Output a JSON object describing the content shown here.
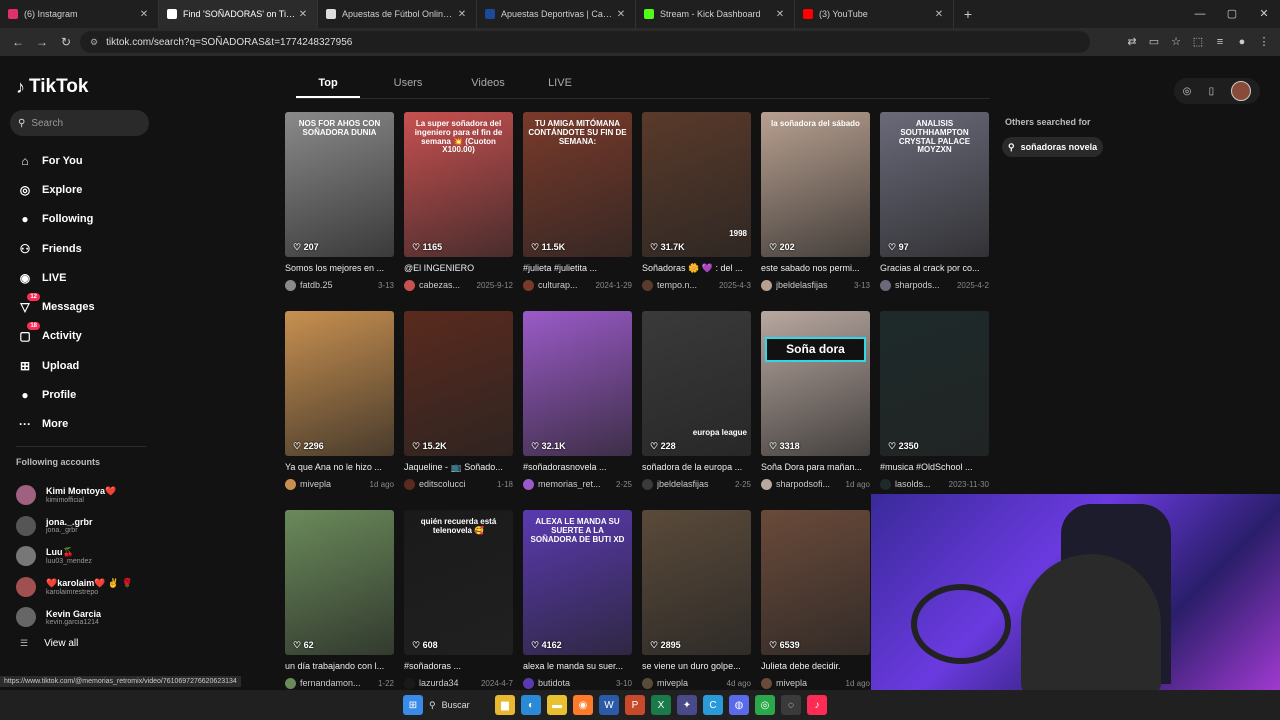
{
  "browser": {
    "tabs": [
      {
        "label": "(6) Instagram",
        "icon": "instagram-icon",
        "color": "#e1306c",
        "active": false
      },
      {
        "label": "Find 'SOÑADORAS' on TikTok | TikTok",
        "icon": "tiktok-icon",
        "color": "#ffffff",
        "active": true
      },
      {
        "label": "Apuestas de Fútbol Online - La",
        "icon": "dollar-icon",
        "color": "#dddddd",
        "active": false
      },
      {
        "label": "Apuestas Deportivas | Casa de A",
        "icon": "betting-icon",
        "color": "#1a4a9a",
        "active": false
      },
      {
        "label": "Stream - Kick Dashboard",
        "icon": "kick-icon",
        "color": "#53fc18",
        "active": false
      },
      {
        "label": "(3) YouTube",
        "icon": "youtube-icon",
        "color": "#ff0000",
        "active": false
      }
    ],
    "new_tab": "+",
    "url": "tiktok.com/search?q=SOÑADORAS&t=1774248327956",
    "status_url": "https://www.tiktok.com/@memorias_retromix/video/7610697276620623134"
  },
  "sidebar": {
    "logo": "TikTok",
    "search_placeholder": "Search",
    "nav": [
      {
        "label": "For You",
        "icon": "home-icon",
        "glyph": "⌂"
      },
      {
        "label": "Explore",
        "icon": "compass-icon",
        "glyph": "◎"
      },
      {
        "label": "Following",
        "icon": "following-avatar-icon",
        "glyph": "●"
      },
      {
        "label": "Friends",
        "icon": "friends-icon",
        "glyph": "⚇"
      },
      {
        "label": "LIVE",
        "icon": "live-icon",
        "glyph": "◉"
      },
      {
        "label": "Messages",
        "icon": "messages-icon",
        "glyph": "▽",
        "badge": "12"
      },
      {
        "label": "Activity",
        "icon": "activity-icon",
        "glyph": "▢",
        "badge": "18"
      },
      {
        "label": "Upload",
        "icon": "upload-icon",
        "glyph": "⊞"
      },
      {
        "label": "Profile",
        "icon": "profile-icon",
        "glyph": "●"
      },
      {
        "label": "More",
        "icon": "more-icon",
        "glyph": "···"
      }
    ],
    "following_title": "Following accounts",
    "following": [
      {
        "name": "Kimi Montoya❤️",
        "handle": "kimimofficial",
        "color": "#a06080"
      },
      {
        "name": "jona._.grbr",
        "handle": "jona._grbr",
        "color": "#555555"
      },
      {
        "name": "Luu🍒",
        "handle": "luu03_mendez",
        "color": "#777777"
      },
      {
        "name": "❤️karolaim❤️ ✌️ 🌹",
        "handle": "karolaimrestrepo",
        "color": "#a05050"
      },
      {
        "name": "Kevin Garcia",
        "handle": "kevin.garcia1214",
        "color": "#666666"
      }
    ],
    "view_all": "View all"
  },
  "search_tabs": [
    {
      "label": "Top",
      "active": true
    },
    {
      "label": "Users",
      "active": false
    },
    {
      "label": "Videos",
      "active": false
    },
    {
      "label": "LIVE",
      "active": false
    }
  ],
  "others": {
    "title": "Others searched for",
    "chip": "soñadoras novela"
  },
  "videos": [
    {
      "views": "207",
      "caption": "Somos los mejores en ...",
      "author": "fatdb.25",
      "date": "3-13",
      "bg": "#8a8a8a",
      "overlay": "NOS FOR AHOS CON SOÑADORA DUNIA"
    },
    {
      "views": "1165",
      "caption": "@El INGENIERO",
      "author": "cabezas...",
      "date": "2025-9-12",
      "bg": "#c85050",
      "overlay": "La super soñadora del ingeniero para el fin de semana 💥 (Cuoton X100.00)"
    },
    {
      "views": "11.5K",
      "caption": "#julieta #julietita ...",
      "author": "culturap...",
      "date": "2024-1-29",
      "bg": "#7a3a2a",
      "overlay": "TU AMIGA MITÓMANA CONTÁNDOTE SU FIN DE SEMANA:"
    },
    {
      "views": "31.7K",
      "caption": "Soñadoras 🌼 💜 : del ...",
      "author": "tempo.n...",
      "date": "2025-4-3",
      "bg": "#5a3a2a",
      "overlay": "1998"
    },
    {
      "views": "202",
      "caption": "este sabado nos permi...",
      "author": "jbeldelasfijas",
      "date": "3-13",
      "bg": "#b8a090",
      "overlay": "la soñadora del sábado"
    },
    {
      "views": "97",
      "caption": "Gracias al crack por co...",
      "author": "sharpods...",
      "date": "2025-4-2",
      "bg": "#6a6a7a",
      "overlay": "ANALISIS SOUTHHAMPTON CRYSTAL PALACE MOYZXN"
    },
    {
      "views": "2296",
      "caption": "Ya que Ana no le hizo ...",
      "author": "mivepla",
      "date": "1d ago",
      "bg": "#c89050",
      "overlay": ""
    },
    {
      "views": "15.2K",
      "caption": "Jaqueline - 📺 Soñado...",
      "author": "editscolucci",
      "date": "1-18",
      "bg": "#5a2a1e",
      "overlay": ""
    },
    {
      "views": "32.1K",
      "caption": "#soñadorasnovela ...",
      "author": "memorias_ret...",
      "date": "2-25",
      "bg": "#9a5ac8",
      "overlay": ""
    },
    {
      "views": "228",
      "caption": "soñadora de la europa ...",
      "author": "jbeldelasfijas",
      "date": "2-25",
      "bg": "#3a3a3a",
      "overlay": "europa league"
    },
    {
      "views": "3318",
      "caption": "Soña Dora para mañan...",
      "author": "sharpodsofi...",
      "date": "1d ago",
      "bg": "#b8a8a0",
      "overlay": "Soña dora"
    },
    {
      "views": "2350",
      "caption": "#musica #OldSchool ...",
      "author": "lasolds...",
      "date": "2023-11-30",
      "bg": "#1e2a2a",
      "overlay": ""
    },
    {
      "views": "62",
      "caption": "un día trabajando con l...",
      "author": "fernandamon...",
      "date": "1-22",
      "bg": "#6a8a5a",
      "overlay": ""
    },
    {
      "views": "608",
      "caption": "#soñadoras ...",
      "author": "lazurda34",
      "date": "2024-4-7",
      "bg": "#1a1a1a",
      "overlay": "quién recuerda está telenovela 🥰"
    },
    {
      "views": "4162",
      "caption": "alexa le manda su suer...",
      "author": "butidota",
      "date": "3-10",
      "bg": "#5a3ab0",
      "overlay": "ALEXA LE MANDA SU SUERTE A LA SOÑADORA DE BUTI XD"
    },
    {
      "views": "2895",
      "caption": "se viene un duro golpe...",
      "author": "mivepla",
      "date": "4d ago",
      "bg": "#5a4a3a",
      "overlay": ""
    },
    {
      "views": "6539",
      "caption": "Julieta debe decidir.",
      "author": "mivepla",
      "date": "1d ago",
      "bg": "#6a4a3a",
      "overlay": ""
    }
  ],
  "taskbar": {
    "search_label": "Buscar",
    "apps": [
      {
        "icon": "windows-start-icon",
        "glyph": "⊞",
        "color": "#3a8ae8"
      },
      {
        "icon": "file-explorer-icon",
        "glyph": "▆",
        "color": "#e8b830"
      },
      {
        "icon": "edge-icon",
        "glyph": "◐",
        "color": "#2a8ad8"
      },
      {
        "icon": "folder-icon",
        "glyph": "▬",
        "color": "#e8c030"
      },
      {
        "icon": "firefox-icon",
        "glyph": "◉",
        "color": "#ff7a2a"
      },
      {
        "icon": "word-icon",
        "glyph": "W",
        "color": "#2a5aa8"
      },
      {
        "icon": "powerpoint-icon",
        "glyph": "P",
        "color": "#c84a2a"
      },
      {
        "icon": "excel-icon",
        "glyph": "X",
        "color": "#1a7a4a"
      },
      {
        "icon": "app-icon",
        "glyph": "✦",
        "color": "#4a4a8a"
      },
      {
        "icon": "c-app-icon",
        "glyph": "C",
        "color": "#2a9ad8"
      },
      {
        "icon": "discord-icon",
        "glyph": "◍",
        "color": "#5a6ae8"
      },
      {
        "icon": "chrome-icon",
        "glyph": "◎",
        "color": "#2aa84a"
      },
      {
        "icon": "obs-icon",
        "glyph": "◌",
        "color": "#3a3a3a"
      },
      {
        "icon": "tiktok-taskbar-icon",
        "glyph": "♪",
        "color": "#fe2c55"
      }
    ]
  }
}
